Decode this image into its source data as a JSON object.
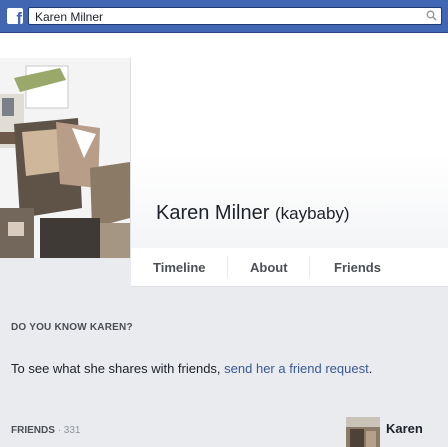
{
  "header": {
    "search_value": "Karen Milner"
  },
  "profile": {
    "name": "Karen Milner",
    "alias": "(kaybaby)"
  },
  "tabs": [
    {
      "label": "Timeline"
    },
    {
      "label": "About"
    },
    {
      "label": "Friends"
    }
  ],
  "know_section": {
    "title": "DO YOU KNOW KAREN?",
    "text_before": "To see what she shares with friends, ",
    "link": "send her a friend request",
    "text_after": "."
  },
  "friends_section": {
    "title": "FRIENDS",
    "count": "331",
    "first_friend_name": "Karen"
  },
  "colors": {
    "brand": "#4267b2",
    "link": "#385898",
    "background": "#e9ebee"
  }
}
